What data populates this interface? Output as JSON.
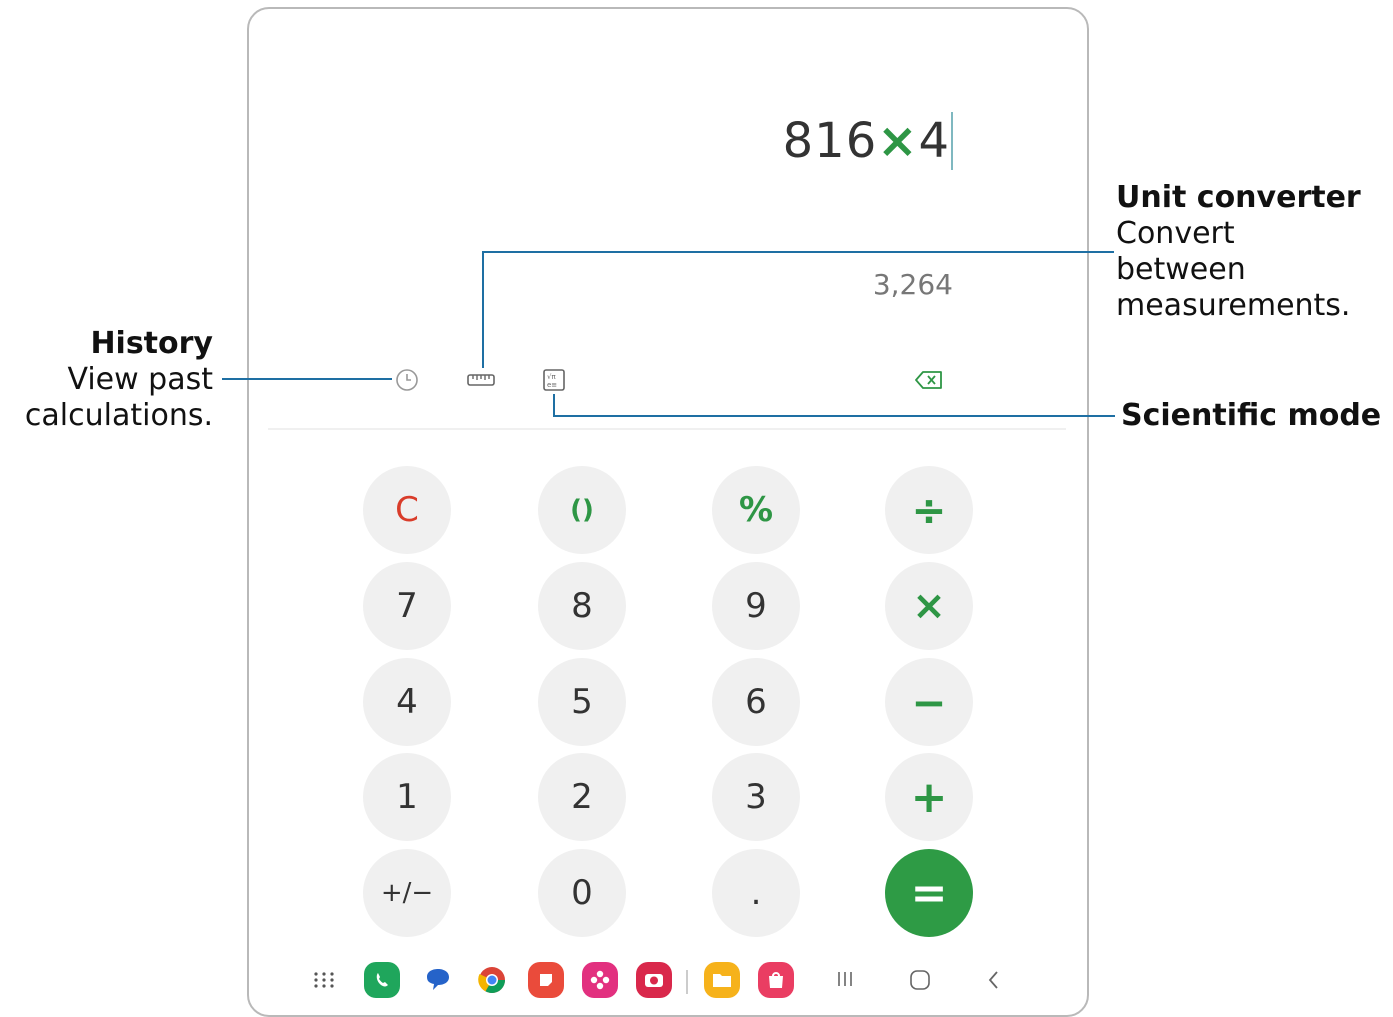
{
  "display": {
    "expression_num1": "816",
    "expression_op": "×",
    "expression_num2": "4",
    "result": "3,264"
  },
  "toolbar": {
    "history_icon": "clock-icon",
    "unit_icon": "ruler-icon",
    "scientific_icon": "scientific-icon",
    "backspace_icon": "backspace-icon"
  },
  "keypad": {
    "clear": "C",
    "parentheses": "()",
    "percent": "%",
    "divide": "÷",
    "seven": "7",
    "eight": "8",
    "nine": "9",
    "multiply": "×",
    "four": "4",
    "five": "5",
    "six": "6",
    "minus": "−",
    "one": "1",
    "two": "2",
    "three": "3",
    "plus": "+",
    "plusminus": "+/−",
    "zero": "0",
    "decimal": ".",
    "equals": "="
  },
  "callouts": {
    "history_title": "History",
    "history_line1": "View past",
    "history_line2": "calculations.",
    "unit_title": "Unit converter",
    "unit_line1": "Convert",
    "unit_line2": "between",
    "unit_line3": "measurements.",
    "scientific_title": "Scientific mode"
  },
  "colors": {
    "accent_green": "#2e9b45",
    "clear_red": "#d93c2a",
    "callout_line": "#1e6fa3"
  }
}
